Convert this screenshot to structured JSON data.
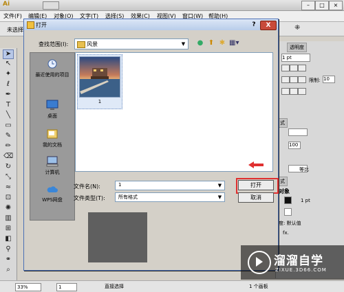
{
  "app": {
    "logo": "Ai",
    "menu": [
      "文件(F)",
      "编辑(E)",
      "对象(O)",
      "文字(T)",
      "选择(S)",
      "效果(C)",
      "视图(V)",
      "窗口(W)",
      "帮助(H)"
    ],
    "toolbar_left": "未选择",
    "status": {
      "zoom": "33%",
      "page": "1",
      "tool": "直接选择",
      "artboards": "1 个画板"
    }
  },
  "right_panel": {
    "tabs": [
      "透明度"
    ],
    "stroke_value": "1 pt",
    "limit_label": "限制:",
    "limit_value": "10",
    "opacity_value": "100",
    "ratio_label": "等比",
    "appearance_title": "对象",
    "appearance_stroke": "1 pt",
    "appearance_opacity": "度: 默认值",
    "fx_label": "fx."
  },
  "dialog": {
    "title": "打开",
    "help": "?",
    "close": "X",
    "look_in_label": "查找范围(I):",
    "look_in_value": "风景",
    "places": [
      "最近使用的项目",
      "桌面",
      "我的文档",
      "计算机",
      "WPS网盘"
    ],
    "file": {
      "caption": "1"
    },
    "file_name_label": "文件名(N):",
    "file_name_value": "1",
    "file_type_label": "文件类型(T):",
    "file_type_value": "所有格式",
    "open_button": "打开",
    "cancel_button": "取消"
  },
  "watermark": {
    "title": "溜溜自学",
    "subtitle": "ZIXUE.3D66.COM"
  }
}
